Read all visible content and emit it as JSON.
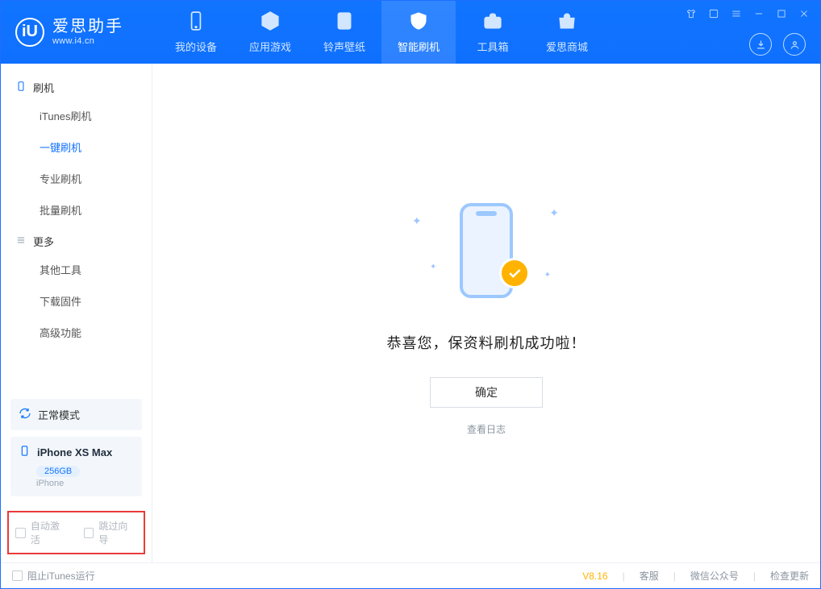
{
  "brand": {
    "name": "爱思助手",
    "url": "www.i4.cn",
    "logo_letter": "iU"
  },
  "window_controls": [
    "shirt",
    "skin",
    "menu",
    "minimize",
    "maximize",
    "close"
  ],
  "header_actions": [
    "download",
    "user"
  ],
  "tabs": [
    {
      "key": "device",
      "label": "我的设备",
      "icon": "phone"
    },
    {
      "key": "apps",
      "label": "应用游戏",
      "icon": "cube"
    },
    {
      "key": "ring",
      "label": "铃声壁纸",
      "icon": "music"
    },
    {
      "key": "flash",
      "label": "智能刷机",
      "icon": "shield",
      "active": true
    },
    {
      "key": "tools",
      "label": "工具箱",
      "icon": "briefcase"
    },
    {
      "key": "shop",
      "label": "爱思商城",
      "icon": "shop"
    }
  ],
  "sidebar": {
    "group_flash": {
      "label": "刷机",
      "icon": "phone-outline"
    },
    "flash_items": [
      {
        "key": "itunes",
        "label": "iTunes刷机"
      },
      {
        "key": "onekey",
        "label": "一键刷机",
        "active": true
      },
      {
        "key": "pro",
        "label": "专业刷机"
      },
      {
        "key": "batch",
        "label": "批量刷机"
      }
    ],
    "group_more": {
      "label": "更多",
      "icon": "menu-lines"
    },
    "more_items": [
      {
        "key": "other",
        "label": "其他工具"
      },
      {
        "key": "firmware",
        "label": "下载固件"
      },
      {
        "key": "advanced",
        "label": "高级功能"
      }
    ],
    "mode": {
      "icon": "sync",
      "label": "正常模式"
    },
    "device": {
      "name": "iPhone XS Max",
      "storage": "256GB",
      "type": "iPhone"
    },
    "checkboxes": {
      "auto_activate": "自动激活",
      "skip_guide": "跳过向导"
    }
  },
  "main": {
    "success_text": "恭喜您，保资料刷机成功啦！",
    "ok_button": "确定",
    "log_link": "查看日志"
  },
  "footer": {
    "stop_itunes": "阻止iTunes运行",
    "version": "V8.16",
    "links": [
      "客服",
      "微信公众号",
      "检查更新"
    ]
  }
}
